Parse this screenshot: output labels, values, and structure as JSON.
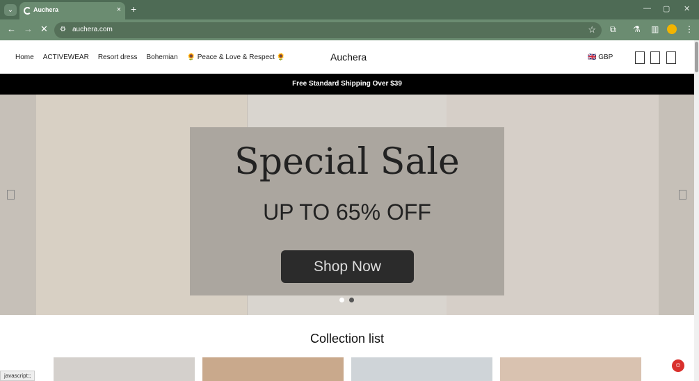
{
  "browser": {
    "tab_title": "Auchera",
    "url": "auchera.com",
    "tab_close": "×",
    "new_tab": "+",
    "window_controls": {
      "minimize": "—",
      "maximize": "▢",
      "close": "✕"
    },
    "nav": {
      "back": "←",
      "forward": "→",
      "reload": "✕"
    },
    "star_icon": "☆"
  },
  "site": {
    "nav_items": [
      "Home",
      "ACTIVEWEAR",
      "Resort dress",
      "Bohemian",
      "🌻 Peace & Love & Respect 🌻"
    ],
    "logo": "Auchera",
    "currency": "🇬🇧 GBP",
    "shipping_banner": "Free Standard Shipping Over $39",
    "hero": {
      "title": "Special Sale",
      "subtitle": "UP TO 65% OFF",
      "button": "Shop Now"
    },
    "collection_title": "Collection list"
  },
  "status_bar": "javascript:;",
  "colors": {
    "chrome": "#4e6b55",
    "accent": "#6b8c71"
  }
}
